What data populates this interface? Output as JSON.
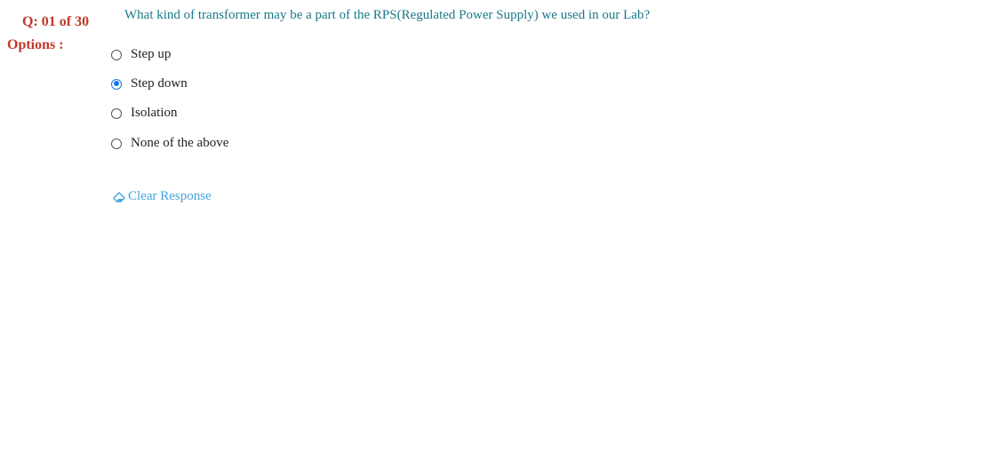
{
  "question": {
    "number": "Q: 01 of 30",
    "options_label": "Options :",
    "text": "What kind of transformer may be a part of the RPS(Regulated Power Supply) we used in our Lab?"
  },
  "options": [
    {
      "label": "Step up",
      "selected": false
    },
    {
      "label": "Step down",
      "selected": true
    },
    {
      "label": "Isolation",
      "selected": false
    },
    {
      "label": "None of the above",
      "selected": false
    }
  ],
  "clear_response": {
    "label": "Clear Response",
    "icon": "eraser-icon"
  },
  "colors": {
    "question_number": "#c0392b",
    "question_text": "#1a7a8a",
    "selected_radio": "#1a73e8",
    "link": "#45a5dc"
  }
}
